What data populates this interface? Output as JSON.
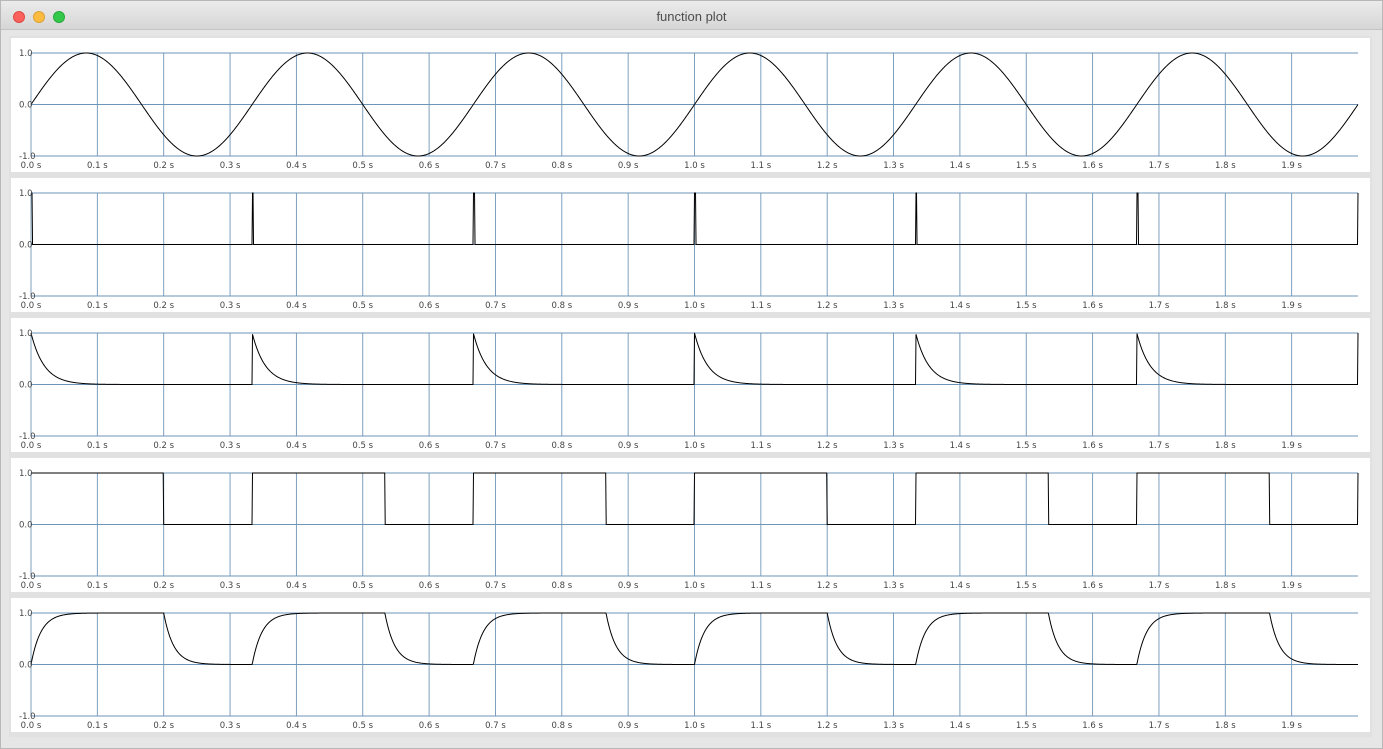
{
  "window": {
    "title": "function plot"
  },
  "chart_data": [
    {
      "type": "line",
      "function": "sine",
      "period": 0.333333,
      "xlim": [
        0,
        2.0
      ],
      "ylim": [
        -1,
        1
      ],
      "xticks": [
        "0.0 s",
        "0.1 s",
        "0.2 s",
        "0.3 s",
        "0.4 s",
        "0.5 s",
        "0.6 s",
        "0.7 s",
        "0.8 s",
        "0.9 s",
        "1.0 s",
        "1.1 s",
        "1.2 s",
        "1.3 s",
        "1.4 s",
        "1.5 s",
        "1.6 s",
        "1.7 s",
        "1.8 s",
        "1.9 s"
      ],
      "yticks": [
        "1.0",
        "0.0",
        "-1.0"
      ],
      "grid": true
    },
    {
      "type": "line",
      "function": "impulse",
      "period": 0.333333,
      "impulse_width": 0.002,
      "xlim": [
        0,
        2.0
      ],
      "ylim": [
        -1,
        1
      ],
      "xticks": [
        "0.0 s",
        "0.1 s",
        "0.2 s",
        "0.3 s",
        "0.4 s",
        "0.5 s",
        "0.6 s",
        "0.7 s",
        "0.8 s",
        "0.9 s",
        "1.0 s",
        "1.1 s",
        "1.2 s",
        "1.3 s",
        "1.4 s",
        "1.5 s",
        "1.6 s",
        "1.7 s",
        "1.8 s",
        "1.9 s"
      ],
      "yticks": [
        "1.0",
        "0.0",
        "-1.0"
      ],
      "grid": true
    },
    {
      "type": "line",
      "function": "decaying_impulse",
      "period": 0.333333,
      "time_constant": 0.02,
      "xlim": [
        0,
        2.0
      ],
      "ylim": [
        -1,
        1
      ],
      "xticks": [
        "0.0 s",
        "0.1 s",
        "0.2 s",
        "0.3 s",
        "0.4 s",
        "0.5 s",
        "0.6 s",
        "0.7 s",
        "0.8 s",
        "0.9 s",
        "1.0 s",
        "1.1 s",
        "1.2 s",
        "1.3 s",
        "1.4 s",
        "1.5 s",
        "1.6 s",
        "1.7 s",
        "1.8 s",
        "1.9 s"
      ],
      "yticks": [
        "1.0",
        "0.0",
        "-1.0"
      ],
      "grid": true
    },
    {
      "type": "line",
      "function": "pulse",
      "period": 0.333333,
      "high_duration": 0.2,
      "xlim": [
        0,
        2.0
      ],
      "ylim": [
        -1,
        1
      ],
      "xticks": [
        "0.0 s",
        "0.1 s",
        "0.2 s",
        "0.3 s",
        "0.4 s",
        "0.5 s",
        "0.6 s",
        "0.7 s",
        "0.8 s",
        "0.9 s",
        "1.0 s",
        "1.1 s",
        "1.2 s",
        "1.3 s",
        "1.4 s",
        "1.5 s",
        "1.6 s",
        "1.7 s",
        "1.8 s",
        "1.9 s"
      ],
      "yticks": [
        "1.0",
        "0.0",
        "-1.0"
      ],
      "grid": true
    },
    {
      "type": "line",
      "function": "smoothed_pulse",
      "period": 0.333333,
      "high_duration": 0.2,
      "time_constant": 0.015,
      "xlim": [
        0,
        2.0
      ],
      "ylim": [
        -1,
        1
      ],
      "xticks": [
        "0.0 s",
        "0.1 s",
        "0.2 s",
        "0.3 s",
        "0.4 s",
        "0.5 s",
        "0.6 s",
        "0.7 s",
        "0.8 s",
        "0.9 s",
        "1.0 s",
        "1.1 s",
        "1.2 s",
        "1.3 s",
        "1.4 s",
        "1.5 s",
        "1.6 s",
        "1.7 s",
        "1.8 s",
        "1.9 s"
      ],
      "yticks": [
        "1.0",
        "0.0",
        "-1.0"
      ],
      "grid": true
    }
  ]
}
